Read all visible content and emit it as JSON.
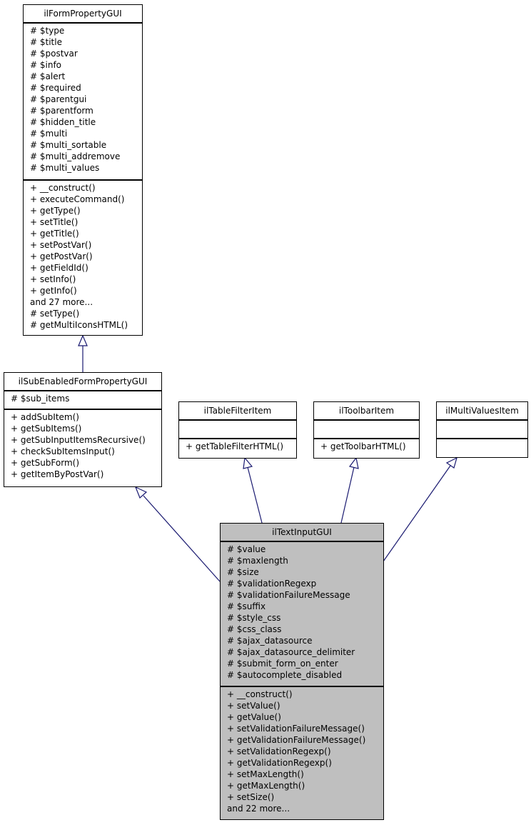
{
  "diagram": {
    "type": "class-inheritance",
    "classes": {
      "form_property_gui": {
        "name": "ilFormPropertyGUI",
        "attributes": [
          "# $type",
          "# $title",
          "# $postvar",
          "# $info",
          "# $alert",
          "# $required",
          "# $parentgui",
          "# $parentform",
          "# $hidden_title",
          "# $multi",
          "# $multi_sortable",
          "# $multi_addremove",
          "# $multi_values"
        ],
        "methods": [
          "+ __construct()",
          "+ executeCommand()",
          "+ getType()",
          "+ setTitle()",
          "+ getTitle()",
          "+ setPostVar()",
          "+ getPostVar()",
          "+ getFieldId()",
          "+ setInfo()",
          "+ getInfo()",
          "and 27 more...",
          "# setType()",
          "# getMultiIconsHTML()"
        ]
      },
      "sub_enabled": {
        "name": "ilSubEnabledFormPropertyGUI",
        "attributes": [
          "# $sub_items"
        ],
        "methods": [
          "+ addSubItem()",
          "+ getSubItems()",
          "+ getSubInputItemsRecursive()",
          "+ checkSubItemsInput()",
          "+ getSubForm()",
          "+ getItemByPostVar()"
        ]
      },
      "table_filter_item": {
        "name": "ilTableFilterItem",
        "attributes": [],
        "methods": [
          "+ getTableFilterHTML()"
        ]
      },
      "toolbar_item": {
        "name": "ilToolbarItem",
        "attributes": [],
        "methods": [
          "+ getToolbarHTML()"
        ]
      },
      "multi_values_item": {
        "name": "ilMultiValuesItem",
        "attributes": [],
        "methods": []
      },
      "text_input_gui": {
        "name": "ilTextInputGUI",
        "attributes": [
          "# $value",
          "# $maxlength",
          "# $size",
          "# $validationRegexp",
          "# $validationFailureMessage",
          "# $suffix",
          "# $style_css",
          "# $css_class",
          "# $ajax_datasource",
          "# $ajax_datasource_delimiter",
          "# $submit_form_on_enter",
          "# $autocomplete_disabled"
        ],
        "methods": [
          "+ __construct()",
          "+ setValue()",
          "+ getValue()",
          "+ setValidationFailureMessage()",
          "+ getValidationFailureMessage()",
          "+ setValidationRegexp()",
          "+ getValidationRegexp()",
          "+ setMaxLength()",
          "+ getMaxLength()",
          "+ setSize()",
          "and 22 more..."
        ]
      }
    },
    "edges": [
      {
        "from": "sub_enabled",
        "to": "form_property_gui",
        "kind": "inherits"
      },
      {
        "from": "text_input_gui",
        "to": "sub_enabled",
        "kind": "inherits"
      },
      {
        "from": "text_input_gui",
        "to": "table_filter_item",
        "kind": "inherits"
      },
      {
        "from": "text_input_gui",
        "to": "toolbar_item",
        "kind": "inherits"
      },
      {
        "from": "text_input_gui",
        "to": "multi_values_item",
        "kind": "inherits"
      }
    ],
    "colors": {
      "edge": "#191970",
      "focus_fill": "#bfbfbf",
      "box_fill": "#ffffff",
      "border": "#000000"
    }
  }
}
